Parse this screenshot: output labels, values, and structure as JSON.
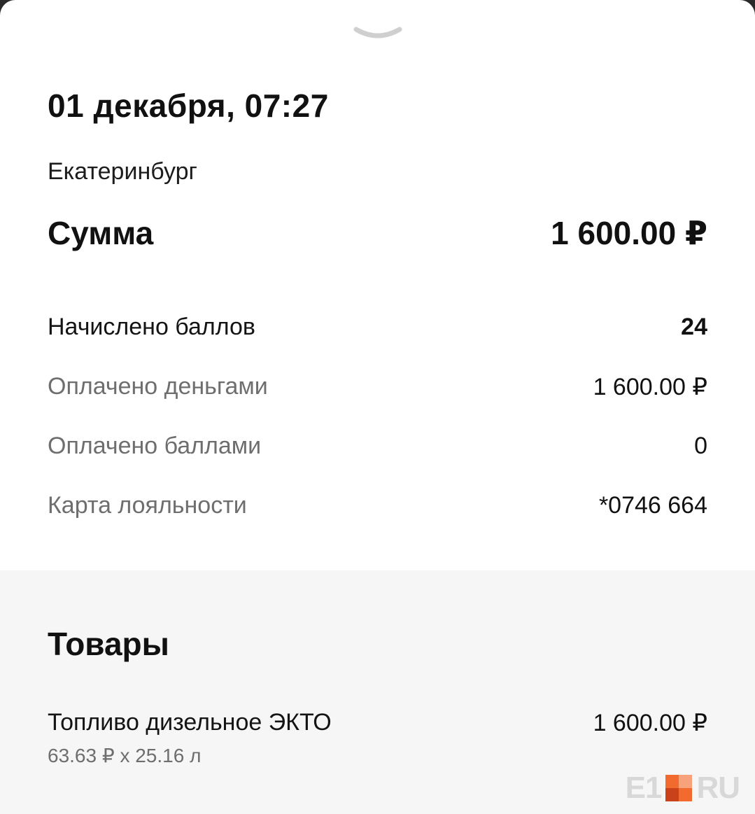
{
  "header": {
    "handle_icon": "chevron-down-icon",
    "date_time": "01 декабря, 07:27",
    "city": "Екатеринбург"
  },
  "total": {
    "label": "Сумма",
    "value": "1 600.00 ₽"
  },
  "details": [
    {
      "label": "Начислено баллов",
      "value": "24"
    },
    {
      "label": "Оплачено деньгами",
      "value": "1 600.00 ₽"
    },
    {
      "label": "Оплачено баллами",
      "value": "0"
    },
    {
      "label": "Карта лояльности",
      "value": "*0746 664"
    }
  ],
  "goods": {
    "title": "Товары",
    "items": [
      {
        "name": "Топливо дизельное ЭКТО",
        "price": "1 600.00 ₽",
        "detail": "63.63 ₽ x 25.16 л"
      }
    ]
  },
  "watermark": {
    "left_text": "E1",
    "right_text": "RU",
    "accent_color": "#f26a2e"
  }
}
